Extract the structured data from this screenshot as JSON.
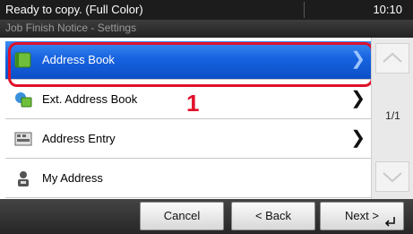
{
  "status": {
    "message": "Ready to copy. (Full Color)",
    "time": "10:10"
  },
  "subheader": {
    "title": "Job Finish Notice - Settings"
  },
  "list": {
    "items": [
      {
        "label": "Address Book",
        "icon": "address-book-icon",
        "selected": true
      },
      {
        "label": "Ext. Address Book",
        "icon": "ext-address-book-icon",
        "selected": false
      },
      {
        "label": "Address Entry",
        "icon": "keyboard-icon",
        "selected": false
      },
      {
        "label": "My Address",
        "icon": "person-icon",
        "selected": false
      }
    ]
  },
  "annotation": {
    "step": "1"
  },
  "pagination": {
    "page": "1/1"
  },
  "buttons": {
    "cancel": "Cancel",
    "back": "< Back",
    "next": "Next >"
  },
  "colors": {
    "selection": "#1763e0",
    "highlight": "#e0102a"
  }
}
